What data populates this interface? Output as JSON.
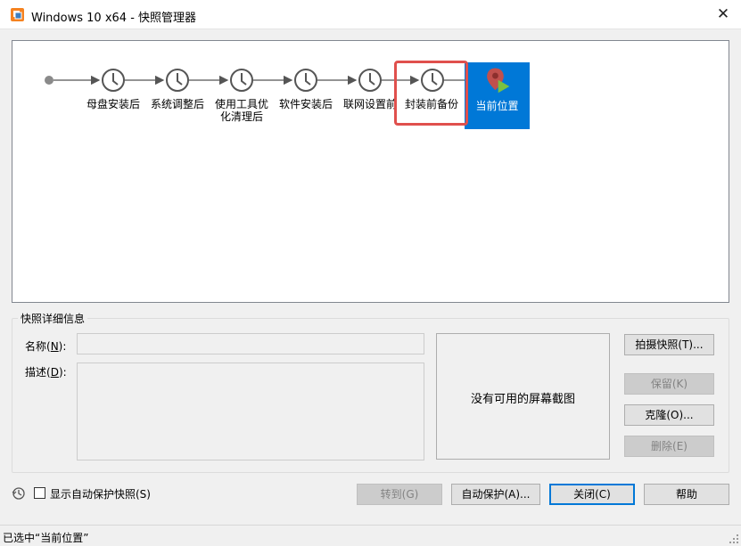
{
  "window": {
    "title": "Windows 10 x64 - 快照管理器",
    "close_glyph": "✕"
  },
  "snapshots": [
    {
      "label": "母盘安装后"
    },
    {
      "label": "系统调整后"
    },
    {
      "label": "使用工具优化清理后"
    },
    {
      "label": "软件安装后"
    },
    {
      "label": "联网设置前"
    },
    {
      "label": "封装前备份"
    }
  ],
  "current": {
    "label": "当前位置"
  },
  "details": {
    "group_title": "快照详细信息",
    "name_label_pre": "名称(",
    "name_key": "N",
    "name_label_post": "):",
    "name_value": "",
    "desc_label_pre": "描述(",
    "desc_key": "D",
    "desc_label_post": "):",
    "desc_value": "",
    "no_screenshot": "没有可用的屏幕截图"
  },
  "buttons": {
    "take_snapshot": "拍摄快照(T)...",
    "keep": "保留(K)",
    "clone": "克隆(O)...",
    "delete": "删除(E)",
    "goto": "转到(G)",
    "autoprotect": "自动保护(A)...",
    "close": "关闭(C)",
    "help": "帮助"
  },
  "footer": {
    "show_autoprotect": "显示自动保护快照(S)"
  },
  "status": {
    "text": "已选中“当前位置”"
  },
  "colors": {
    "accent": "#0078d7",
    "highlight": "#e0504d"
  },
  "icons": [
    "app-icon",
    "clock-icon",
    "location-pin-icon",
    "play-icon",
    "history-icon",
    "resize-grip-icon"
  ]
}
